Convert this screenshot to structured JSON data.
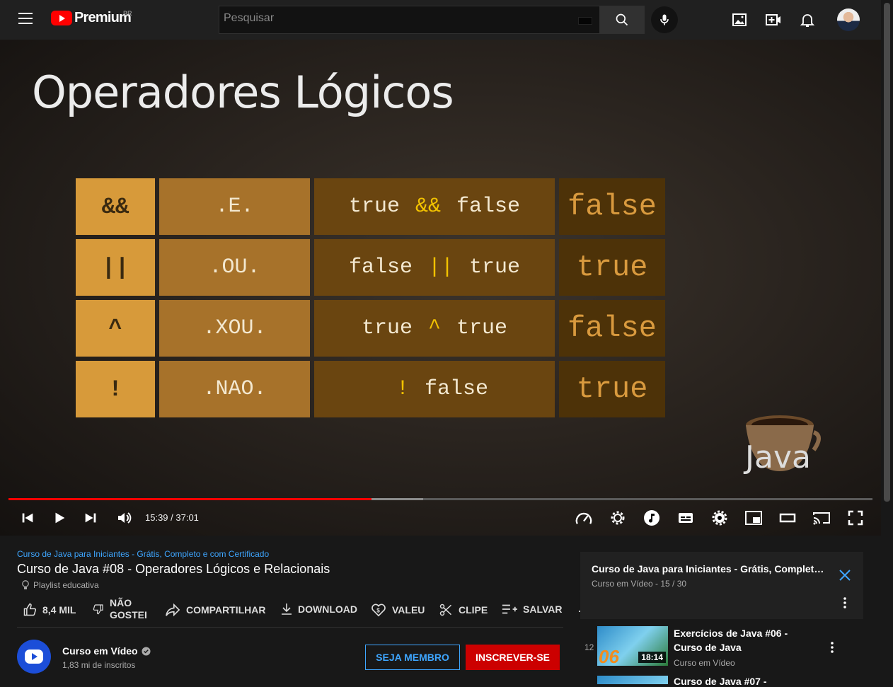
{
  "topbar": {
    "logo_text": "Premium",
    "country": "BR",
    "search_placeholder": "Pesquisar"
  },
  "video": {
    "slide_title": "Operadores Lógicos",
    "table": [
      {
        "op": "&&",
        "word": ".E.",
        "expr_left": "true",
        "expr_op": "&&",
        "expr_right": "false",
        "result": "false"
      },
      {
        "op": "||",
        "word": ".OU.",
        "expr_left": "false",
        "expr_op": "||",
        "expr_right": "true",
        "result": "true"
      },
      {
        "op": "^",
        "word": ".XOU.",
        "expr_left": "true",
        "expr_op": "^",
        "expr_right": "true",
        "result": "false"
      },
      {
        "op": "!",
        "word": ".NAO.",
        "expr_left": "",
        "expr_op": "!",
        "expr_right": "false",
        "result": "true"
      }
    ],
    "watermark": "Java",
    "time": "15:39 / 37:01",
    "played_fraction": 0.42
  },
  "info": {
    "playlist_link": "Curso de Java para Iniciantes - Grátis, Completo e com Certificado",
    "title": "Curso de Java #08 - Operadores Lógicos e Relacionais",
    "tag": "Playlist educativa",
    "actions": {
      "like": "8,4 MIL",
      "dislike_1": "NÃO",
      "dislike_2": "GOSTEI",
      "share": "COMPARTILHAR",
      "download": "DOWNLOAD",
      "valeu": "VALEU",
      "clip": "CLIPE",
      "save": "SALVAR"
    },
    "channel": {
      "name": "Curso em Vídeo",
      "subs": "1,83 mi de inscritos",
      "member_btn": "SEJA MEMBRO",
      "subscribe_btn": "INSCREVER-SE"
    }
  },
  "playlist": {
    "title": "Curso de Java para Iniciantes - Grátis, Completo e ...",
    "sub": "Curso em Vídeo - 15 / 30",
    "items": [
      {
        "index": "12",
        "title": "Exercícios de Java #06 - Curso de Java",
        "channel": "Curso em Vídeo",
        "duration": "18:14",
        "thumb_num": "06"
      },
      {
        "title": "Curso de Java #07 -"
      }
    ]
  },
  "colors": {
    "accent_red": "#ff0000",
    "link_blue": "#3ea6ff",
    "subscribe_red": "#cc0000"
  }
}
